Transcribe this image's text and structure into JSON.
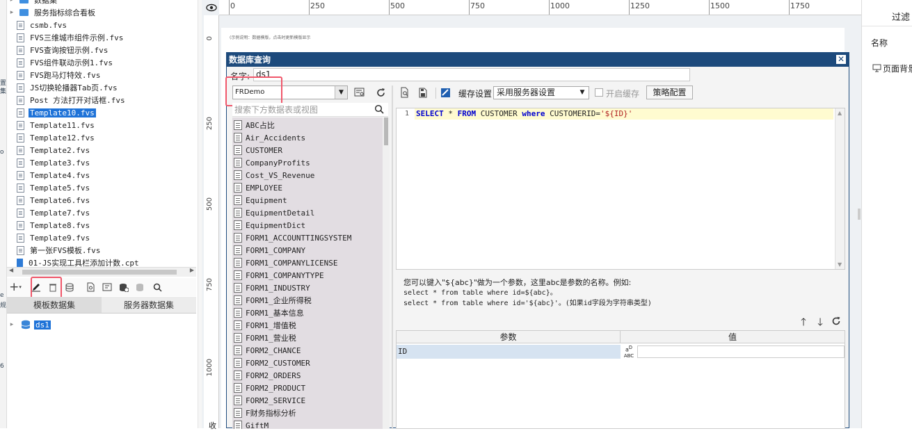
{
  "left_strip": {
    "glyphs": [
      "置",
      "集",
      "o",
      "e",
      "规",
      "6"
    ]
  },
  "file_tree": {
    "items": [
      {
        "label": "数据集",
        "type": "folder",
        "collapsed": true
      },
      {
        "label": "服务指标综合看板",
        "type": "folder",
        "collapsed": true
      },
      {
        "label": "csmb.fvs",
        "type": "file"
      },
      {
        "label": "FVS三维城市组件示例.fvs",
        "type": "file"
      },
      {
        "label": "FVS查询按钮示例.fvs",
        "type": "file"
      },
      {
        "label": "FVS组件联动示例1.fvs",
        "type": "file"
      },
      {
        "label": "FVS跑马灯特效.fvs",
        "type": "file"
      },
      {
        "label": "JS切换轮播器Tab页.fvs",
        "type": "file"
      },
      {
        "label": "Post 方法打开对话框.fvs",
        "type": "file"
      },
      {
        "label": "Template10.fvs",
        "type": "file",
        "selected": true
      },
      {
        "label": "Template11.fvs",
        "type": "file"
      },
      {
        "label": "Template12.fvs",
        "type": "file"
      },
      {
        "label": "Template2.fvs",
        "type": "file"
      },
      {
        "label": "Template3.fvs",
        "type": "file"
      },
      {
        "label": "Template4.fvs",
        "type": "file"
      },
      {
        "label": "Template5.fvs",
        "type": "file"
      },
      {
        "label": "Template6.fvs",
        "type": "file"
      },
      {
        "label": "Template7.fvs",
        "type": "file"
      },
      {
        "label": "Template8.fvs",
        "type": "file"
      },
      {
        "label": "Template9.fvs",
        "type": "file"
      },
      {
        "label": "第一张FVS模板.fvs",
        "type": "file"
      },
      {
        "label": "01-JS实现工具栏添加计数.cpt",
        "type": "cpt"
      }
    ]
  },
  "dataset_panel": {
    "tabs": [
      "模板数据集",
      "服务器数据集"
    ],
    "active_tab": 0,
    "items": [
      {
        "label": "ds1",
        "selected": true
      }
    ]
  },
  "rulers": {
    "top_ticks": [
      "0",
      "250",
      "500",
      "750",
      "1000",
      "1250",
      "1500",
      "1750"
    ],
    "left_ticks": [
      "0",
      "250",
      "500",
      "750",
      "1000"
    ]
  },
  "canvas": {
    "note": "(示例说明：数据模版，点击时更新模版显示",
    "bottom_tab": "收"
  },
  "right_panel": {
    "title": "过滤",
    "name_label": "名称",
    "page_bg": "页面背景"
  },
  "dialog": {
    "title": "数据库查询",
    "close": "✕",
    "name_label": "名字:",
    "name_value": "ds1",
    "connection": "FRDemo",
    "search_placeholder": "搜索下方数据表或视图",
    "tables": [
      "ABC占比",
      "Air_Accidents",
      "CUSTOMER",
      "CompanyProfits",
      "Cost_VS_Revenue",
      "EMPLOYEE",
      "Equipment",
      "EquipmentDetail",
      "EquipmentDict",
      "FORM1_ACCOUNTTINGSYSTEM",
      "FORM1_COMPANY",
      "FORM1_COMPANYLICENSE",
      "FORM1_COMPANYTYPE",
      "FORM1_INDUSTRY",
      "FORM1_企业所得税",
      "FORM1_基本信息",
      "FORM1_增值税",
      "FORM1_营业税",
      "FORM2_CHANCE",
      "FORM2_CUSTOMER",
      "FORM2_ORDERS",
      "FORM2_PRODUCT",
      "FORM2_SERVICE",
      "F财务指标分析",
      "GiftM"
    ],
    "toolbar": {
      "cache_label": "缓存设置",
      "cache_option": "采用服务器设置",
      "enable_cache": "开启缓存",
      "strategy": "策略配置"
    },
    "sql": {
      "line_no": "1",
      "kw1": "SELECT",
      "t1": " * ",
      "kw2": "FROM",
      "t2": " CUSTOMER ",
      "kw3": "where",
      "t3": " CUSTOMERID=",
      "s1": "'",
      "param": "${ID}",
      "s2": "'"
    },
    "hint": {
      "line1": "您可以键入\"${abc}\"做为一个参数，这里abc是参数的名称。例如:",
      "line2": "select * from table where id=${abc}。",
      "line3": "select * from table where id='${abc}'。(如果id字段为字符串类型)"
    },
    "param_table": {
      "col_param": "参数",
      "col_value": "值",
      "rows": [
        {
          "name": "ID",
          "type_icon": "ABC",
          "value": ""
        }
      ]
    }
  }
}
